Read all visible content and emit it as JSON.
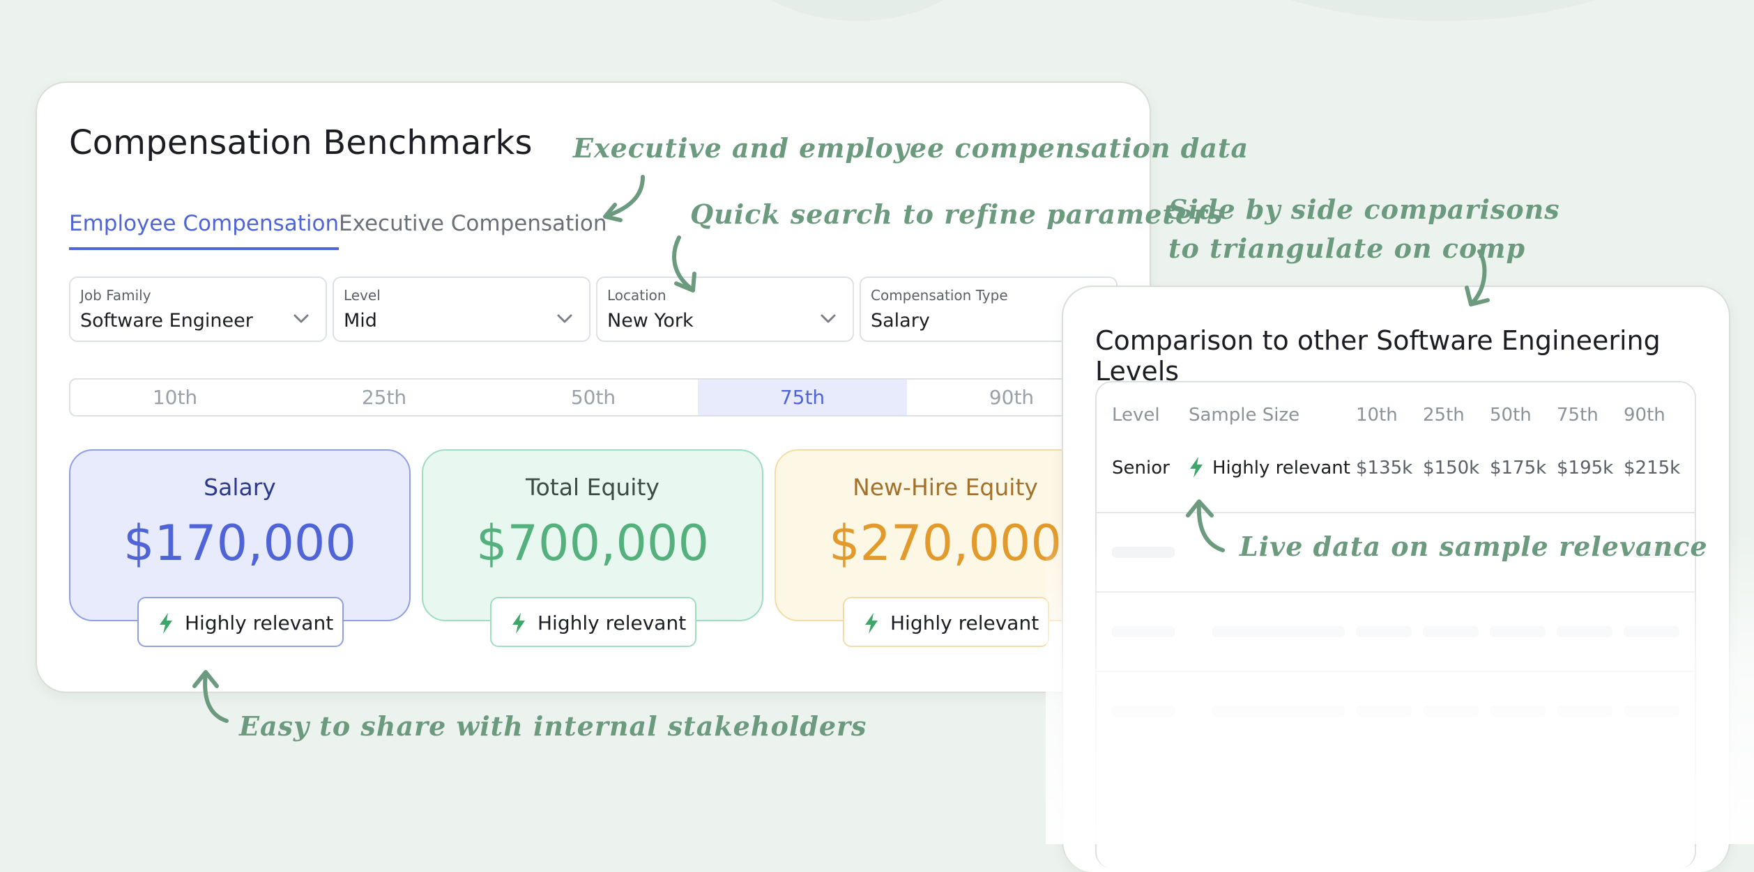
{
  "main": {
    "title": "Compensation Benchmarks",
    "tabs": [
      {
        "label": "Employee Compensation",
        "active": true
      },
      {
        "label": "Executive Compensation",
        "active": false
      }
    ],
    "filters": [
      {
        "label": "Job Family",
        "value": "Software Engineer"
      },
      {
        "label": "Level",
        "value": "Mid"
      },
      {
        "label": "Location",
        "value": "New York"
      },
      {
        "label": "Compensation Type",
        "value": "Salary"
      }
    ],
    "percentiles": [
      "10th",
      "25th",
      "50th",
      "75th",
      "90th"
    ],
    "selected_percentile": "75th",
    "metrics": [
      {
        "label": "Salary",
        "value": "$170,000",
        "badge": "Highly relevant"
      },
      {
        "label": "Total Equity",
        "value": "$700,000",
        "badge": "Highly relevant"
      },
      {
        "label": "New-Hire Equity",
        "value": "$270,000",
        "badge": "Highly relevant"
      }
    ]
  },
  "comparison": {
    "title": "Comparison to other Software Engineering Levels",
    "columns": [
      "Level",
      "Sample Size",
      "10th",
      "25th",
      "50th",
      "75th",
      "90th"
    ],
    "rows": [
      {
        "level": "Senior",
        "sample": "Highly relevant",
        "p10": "$135k",
        "p25": "$150k",
        "p50": "$175k",
        "p75": "$195k",
        "p90": "$215k"
      }
    ]
  },
  "annotations": {
    "exec_data": "Executive and employee compensation data",
    "quick_search": "Quick search to refine parameters",
    "side_by_side_1": "Side by side comparisons",
    "side_by_side_2": "to triangulate on comp",
    "live_data": "Live data on sample relevance",
    "share": "Easy to share with internal stakeholders"
  },
  "colors": {
    "accent": "#4f64d6",
    "annotation": "#6b9a7e",
    "salary_bg": "#e8ebfc",
    "salary_border": "#8f9fe3",
    "salary_text": "#4f64d6",
    "equity_bg": "#e8f8f0",
    "equity_border": "#9fdcc0",
    "equity_text": "#54b07d",
    "newhire_bg": "#fdf7e6",
    "newhire_border": "#f3dca8",
    "newhire_text": "#e39a2c",
    "bolt": "#3fa66a"
  },
  "icons": [
    "chevron-down-icon",
    "lightning-bolt-icon",
    "curved-arrow-icon"
  ]
}
